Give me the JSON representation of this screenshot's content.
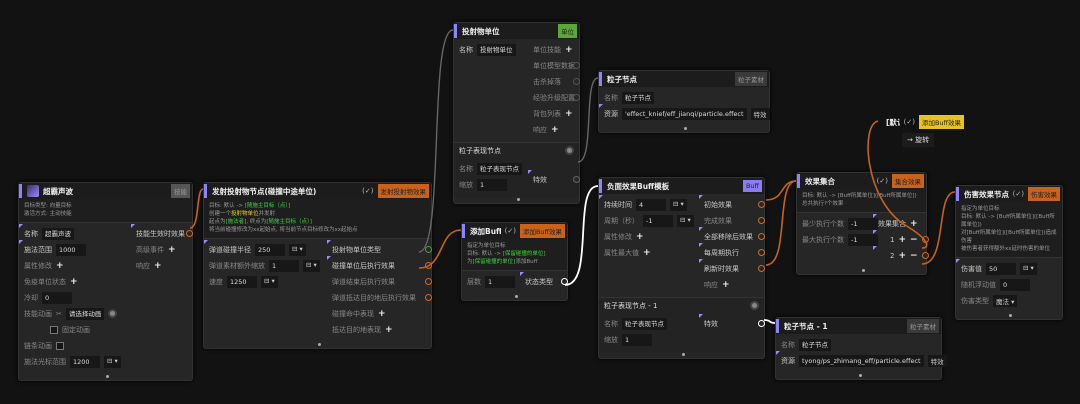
{
  "colors": {
    "orange": "#c8621c",
    "green_badge": "#5aa83a",
    "buff_badge": "#8c7cf2",
    "yellow_badge": "#e8c21e",
    "grey_badge": "#444444",
    "edge_white": "#ffffff",
    "edge_grey": "#666666"
  },
  "nodes": [
    {
      "id": "a",
      "title": "超霸声波",
      "icon": true,
      "badge": "技能",
      "badge_color": "#555555",
      "check": null,
      "desc": [
        [
          {
            "t": "目标类型: 向量目标"
          }
        ],
        [
          {
            "t": "激活方式: 主动技能"
          }
        ]
      ],
      "left": [
        {
          "type": "field",
          "label": "名称",
          "value": "超霸声波",
          "mark": true
        },
        {
          "type": "field",
          "label": "施法范围",
          "value": "1000",
          "mark": true
        },
        {
          "type": "plus",
          "label": "属性修改",
          "dim": true
        },
        {
          "type": "plus",
          "label": "免疫单位状态",
          "dim": true
        },
        {
          "type": "field",
          "label": "冷却",
          "value": "0",
          "dim": true
        },
        {
          "type": "anim",
          "label": "技能动画",
          "value": "请选择动画",
          "dim": true
        },
        {
          "type": "check",
          "label": "固定动画",
          "dim": true
        },
        {
          "type": "labelcheck",
          "label": "链条动画",
          "dim": true
        },
        {
          "type": "field",
          "label": "施法光标范围",
          "value": "1200",
          "dd": true,
          "dim": true
        }
      ],
      "right": [
        {
          "type": "port",
          "label": "技能生效时效果",
          "mark": true
        },
        {
          "type": "plus",
          "label": "高级事件",
          "dim": true
        },
        {
          "type": "plus",
          "label": "响应",
          "dim": true
        }
      ]
    },
    {
      "id": "b",
      "title": "发射投射物节点(碰撞中途单位)",
      "badge": "发射投射物效果",
      "badge_color": "#c8621c",
      "check": "(✓)",
      "desc": [
        [
          {
            "t": "目标: 默认 -> "
          },
          {
            "t": "[随施主目标（点）]",
            "c": "g"
          }
        ],
        [
          {
            "t": " "
          }
        ],
        [
          {
            "t": "创建一个"
          },
          {
            "t": "投射物单位",
            "c": "y"
          },
          {
            "t": "并发射"
          }
        ],
        [
          {
            "t": "起点为"
          },
          {
            "t": "[施法者]",
            "c": "g"
          },
          {
            "t": ", 终点为"
          },
          {
            "t": "[随施主目标（点）]",
            "c": "g"
          }
        ],
        [
          {
            "t": "将当前碰撞修改为xx起始点, 将当前节点目标修改为xx起始点"
          }
        ]
      ],
      "left": [
        {
          "type": "field",
          "label": "弹道碰撞半径",
          "value": "250",
          "dd": true,
          "mark": true
        },
        {
          "type": "field",
          "label": "弹道素材额外缩放",
          "value": "1",
          "dd": true,
          "dim": true
        },
        {
          "type": "field",
          "label": "速度",
          "value": "1250",
          "dd": true,
          "dim": true
        }
      ],
      "right": [
        {
          "type": "port",
          "label": "投射物单位类型",
          "color": "#3fa03f",
          "mark": true
        },
        {
          "type": "port",
          "label": "碰撞单位后执行效果",
          "mark": true
        },
        {
          "type": "port",
          "label": "弹道结束后执行效果",
          "dim": true
        },
        {
          "type": "port",
          "label": "弹道抵达目的地后执行效果",
          "dim": true
        },
        {
          "type": "plus",
          "label": "碰撞命中表现",
          "dim": true
        },
        {
          "type": "plus",
          "label": "抵达目的地表现",
          "dim": true
        }
      ]
    },
    {
      "id": "c",
      "title": "投射物单位",
      "badge": "单位",
      "badge_color": "#5aa83a",
      "check": null,
      "desc": [],
      "left": [
        {
          "type": "field",
          "label": "名称",
          "value": "投射物单位"
        }
      ],
      "right": [
        {
          "type": "plus",
          "label": "单位技能",
          "dim": true
        },
        {
          "type": "hollow",
          "label": "单位模型数据",
          "dim": true
        },
        {
          "type": "hollow",
          "label": "击杀掉落",
          "dim": true
        },
        {
          "type": "hollow",
          "label": "经验升级配置",
          "dim": true
        },
        {
          "type": "plus",
          "label": "背包列表",
          "dim": true
        },
        {
          "type": "plus",
          "label": "响应",
          "dim": true
        }
      ],
      "sub": {
        "title": "粒子表现节点",
        "left": [
          {
            "type": "field",
            "label": "名称",
            "value": "粒子表现节点",
            "dim": true
          },
          {
            "type": "field",
            "label": "缩放",
            "value": "1",
            "dim": true
          }
        ],
        "right": [
          {
            "type": "gap"
          },
          {
            "type": "port",
            "label": "特效",
            "color": "#666666",
            "mark": true
          }
        ]
      }
    },
    {
      "id": "d",
      "title": "粒子节点",
      "badge": "粒子素材",
      "badge_color": "#3a3a3a",
      "check": null,
      "desc": [],
      "left": [
        {
          "type": "field",
          "label": "名称",
          "value": "粒子节点",
          "dim": true
        },
        {
          "type": "fieldbtn",
          "label": "资源",
          "value": "'effect_knief/eff_jianqi/particle.effect",
          "btn": "特效",
          "mark": true
        }
      ],
      "right": []
    },
    {
      "id": "e",
      "title": "添加Buff节点",
      "badge": "添加Buff效果",
      "badge_color": "#c8621c",
      "check": "(✓)",
      "desc": [
        [
          {
            "t": "指定为单位目标"
          }
        ],
        [
          {
            "t": "目标: 默认 -> "
          },
          {
            "t": "[保留碰撞的单位]",
            "c": "g"
          }
        ],
        [
          {
            "t": " "
          }
        ],
        [
          {
            "t": "为"
          },
          {
            "t": "[保留碰撞的单位]",
            "c": "g"
          },
          {
            "t": "添加Buff"
          }
        ]
      ],
      "left": [
        {
          "type": "field",
          "label": "层数",
          "value": "1",
          "dim": true
        }
      ],
      "right": [
        {
          "type": "port",
          "label": "状态类型",
          "color": "#ffffff",
          "mark": true
        }
      ]
    },
    {
      "id": "f",
      "title": "负面效果Buff模板",
      "badge": "Buff",
      "badge_color": "#8c7cf2",
      "check": null,
      "desc": [],
      "left": [
        {
          "type": "field",
          "label": "持续时间",
          "value": "4",
          "dd": true,
          "mark": true
        },
        {
          "type": "field",
          "label": "周期（秒）",
          "value": "-1",
          "dd": true,
          "dim": true
        },
        {
          "type": "plus",
          "label": "属性修改",
          "dim": true
        },
        {
          "type": "plus",
          "label": "属性最大值",
          "dim": true
        }
      ],
      "right": [
        {
          "type": "port",
          "label": "初始效果",
          "mark": true
        },
        {
          "type": "port",
          "label": "完成效果",
          "dim": true
        },
        {
          "type": "port",
          "label": "全部移除后效果",
          "mark": true
        },
        {
          "type": "port",
          "label": "每周期执行",
          "mark": true
        },
        {
          "type": "port",
          "label": "刷新时效果",
          "mark": true
        },
        {
          "type": "plus",
          "label": "响应",
          "dim": true
        }
      ],
      "sub": {
        "title": "粒子表现节点 - 1",
        "left": [
          {
            "type": "field",
            "label": "名称",
            "value": "粒子表现节点",
            "dim": true
          },
          {
            "type": "field",
            "label": "缩放",
            "value": "1",
            "dim": true
          }
        ],
        "right": [
          {
            "type": "port",
            "label": "特效",
            "color": "#ffffff",
            "mark": true
          }
        ]
      }
    },
    {
      "id": "g",
      "title": "粒子节点 - 1",
      "badge": "粒子素材",
      "badge_color": "#3a3a3a",
      "check": null,
      "desc": [],
      "left": [
        {
          "type": "field",
          "label": "名称",
          "value": "粒子节点",
          "dim": true
        },
        {
          "type": "fieldbtn",
          "label": "资源",
          "value": "tyong/ps_zhimang_eff/particle.effect",
          "btn": "特效",
          "mark": true
        }
      ],
      "right": []
    },
    {
      "id": "h",
      "title": "效果集合",
      "badge": "集合效果",
      "badge_color": "#c8621c",
      "check": "(✓)",
      "desc": [
        [
          {
            "t": "目标: 默认 -> [Buff所属单位]([Buff所属单位])"
          }
        ],
        [
          {
            "t": " "
          }
        ],
        [
          {
            "t": "总共执行?个效果"
          }
        ]
      ],
      "left": [
        {
          "type": "field",
          "label": "最少执行个数",
          "value": "-1",
          "dim": true
        },
        {
          "type": "field",
          "label": "最大执行个数",
          "value": "-1",
          "dim": true
        }
      ],
      "right": [
        {
          "type": "rplus",
          "label": "效果集合",
          "mark": true
        },
        {
          "type": "multi",
          "label": "1",
          "mark": true
        },
        {
          "type": "multi",
          "label": "2",
          "mark": true
        }
      ]
    },
    {
      "id": "i",
      "title": "伤害效果节点",
      "badge": "伤害效果",
      "badge_color": "#c8621c",
      "check": "(✓)",
      "desc": [
        [
          {
            "t": "指定为单位目标"
          }
        ],
        [
          {
            "t": "目标: 默认 -> [Buff所属单位]([Buff所属单位])"
          }
        ],
        [
          {
            "t": " "
          }
        ],
        [
          {
            "t": "对[Buff所属单位]([Buff所属单位])造成伤害"
          }
        ],
        [
          {
            "t": "被伤害者获得额外xx延时伤害的单位"
          }
        ]
      ],
      "left": [
        {
          "type": "field",
          "label": "伤害值",
          "value": "50",
          "dd": true,
          "mark": true
        },
        {
          "type": "field",
          "label": "随机浮动值",
          "value": "0",
          "dim": true
        },
        {
          "type": "select",
          "label": "伤害类型",
          "value": "魔法",
          "dim": true
        }
      ],
      "right": []
    },
    {
      "id": "j",
      "title": "[默认]...",
      "badge": "添加Buff效果",
      "badge_color": "#e8c21e",
      "check": "(✓)",
      "bar": false,
      "desc": [],
      "left": [],
      "right": [],
      "extra": "→ 旋转"
    }
  ]
}
